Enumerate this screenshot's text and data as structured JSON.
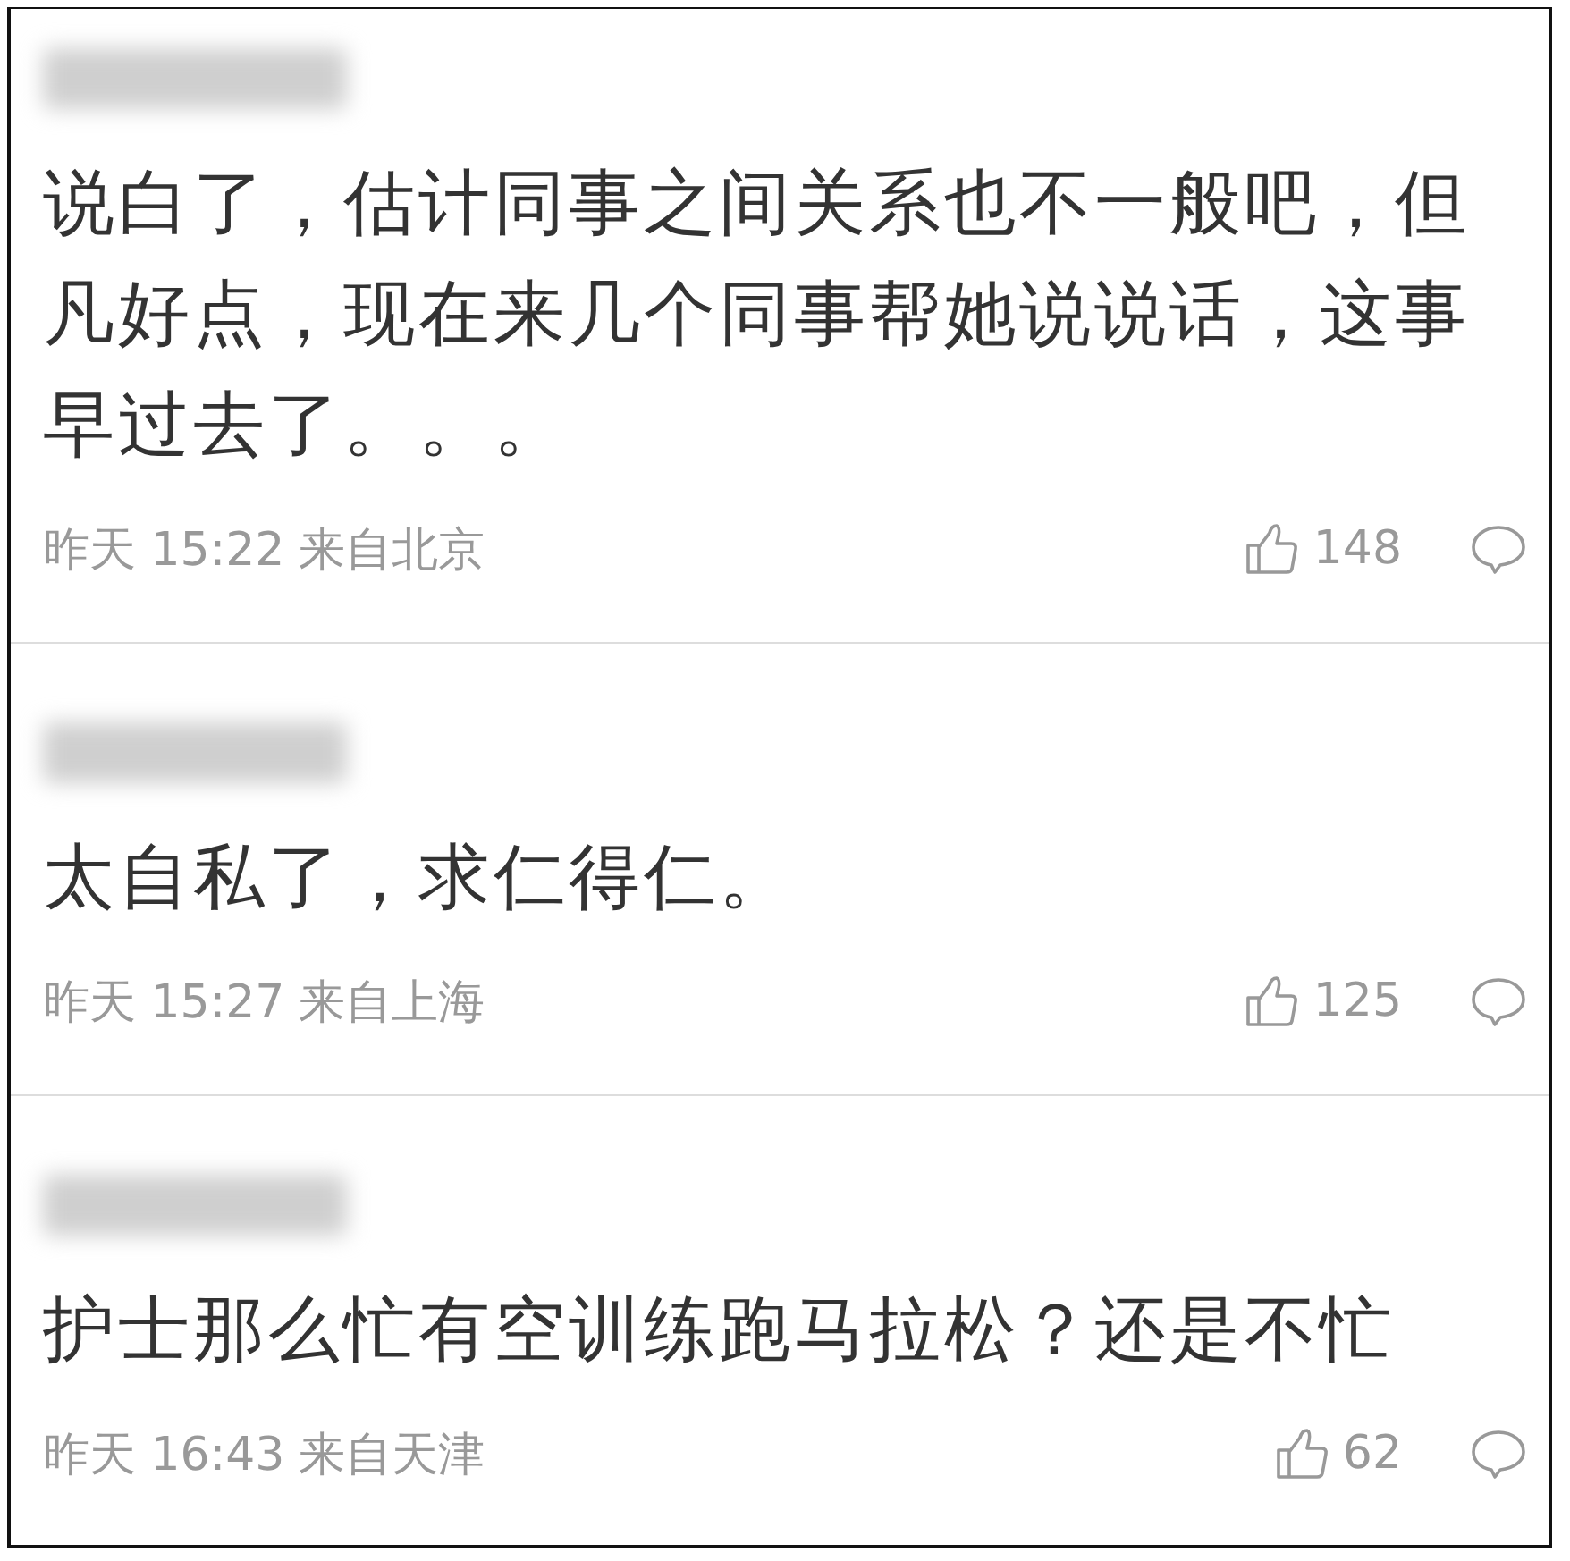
{
  "comments": [
    {
      "text": "说白了，估计同事之间关系也不一般吧，但凡好点，现在来几个同事帮她说说话，这事早过去了。。。",
      "time": "昨天 15:22",
      "location": "来自北京",
      "likes": "148"
    },
    {
      "text": "太自私了，求仁得仁。",
      "time": "昨天 15:27",
      "location": "来自上海",
      "likes": "125"
    },
    {
      "text": "护士那么忙有空训练跑马拉松？还是不忙",
      "time": "昨天 16:43",
      "location": "来自天津",
      "likes": "62"
    }
  ]
}
